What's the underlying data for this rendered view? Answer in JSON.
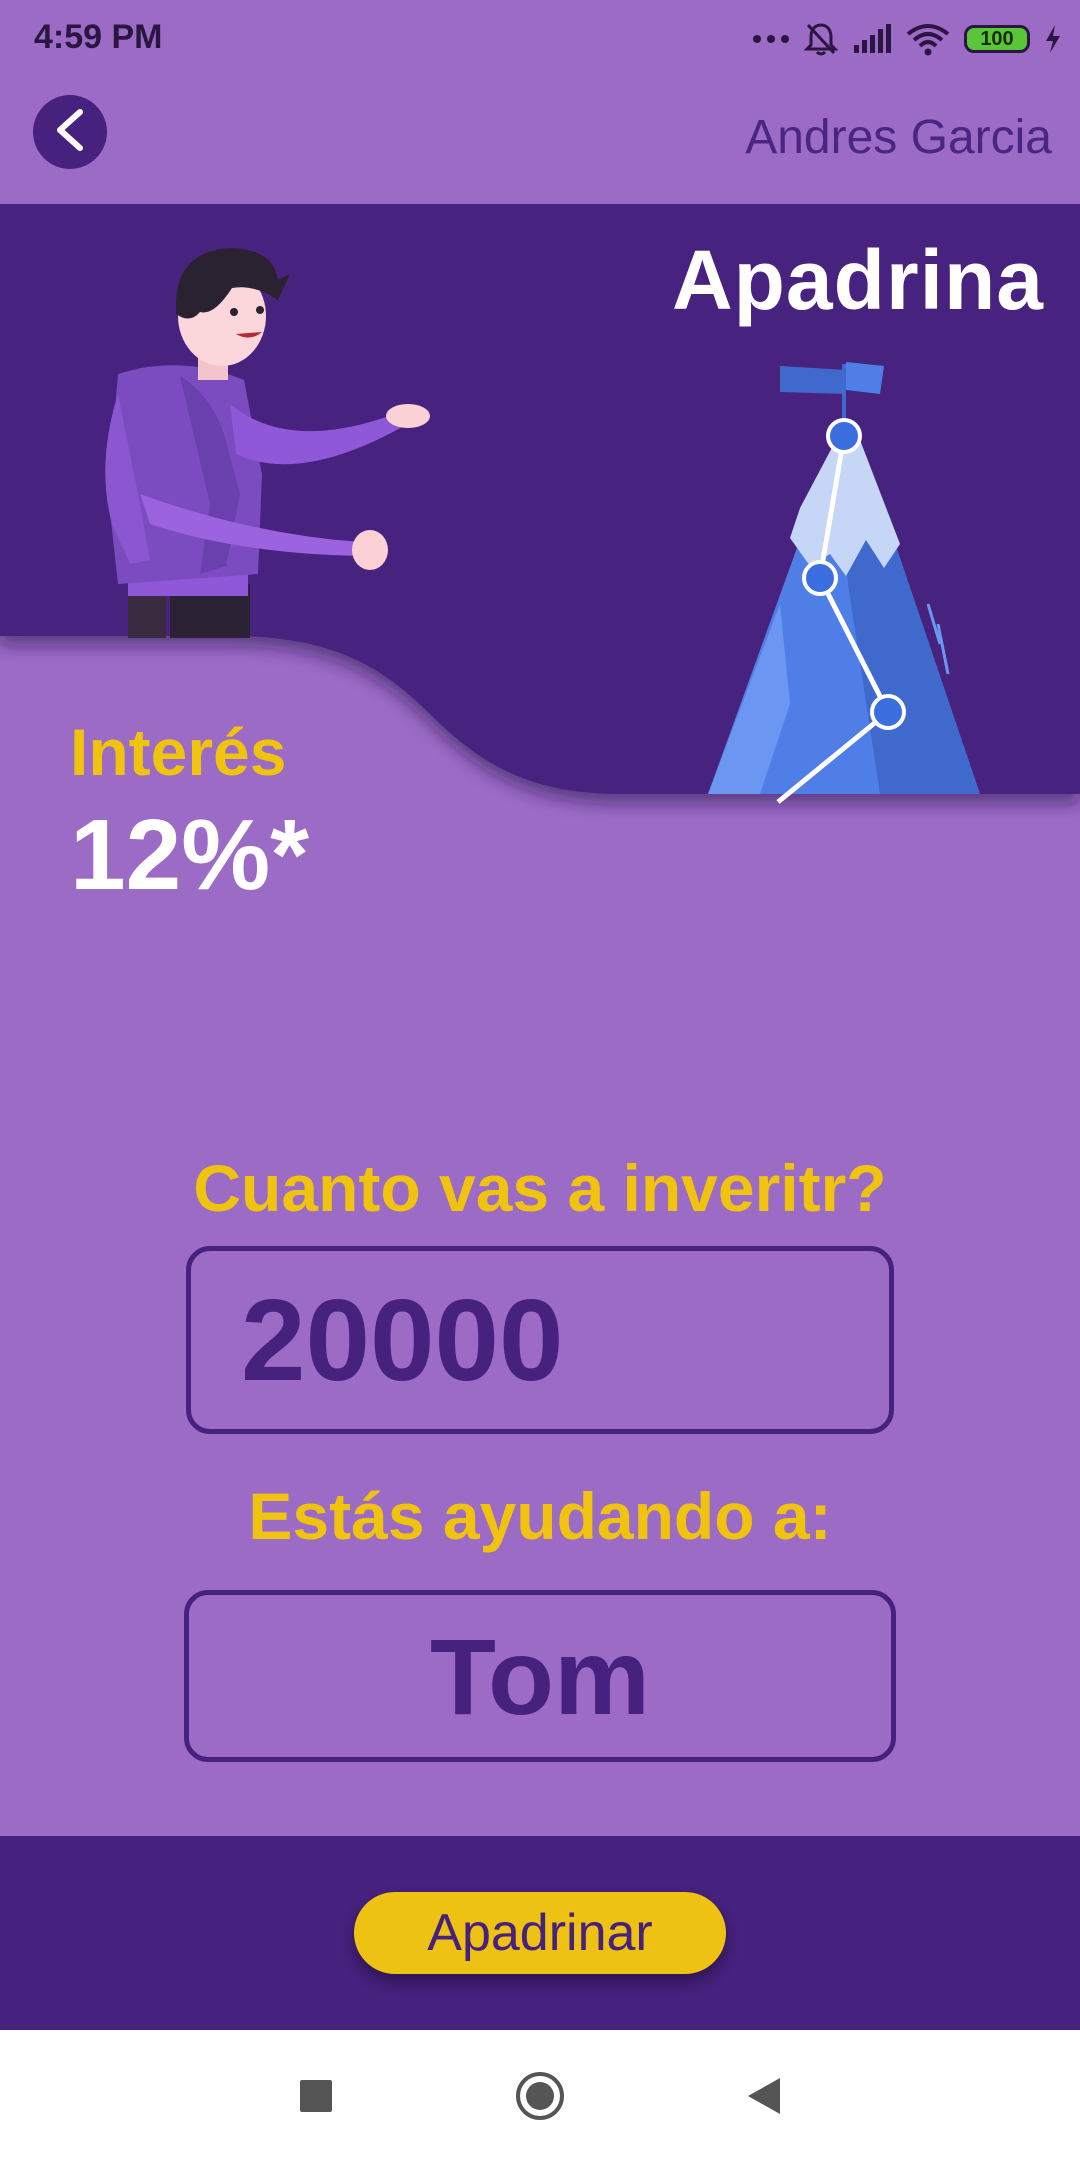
{
  "status_bar": {
    "time": "4:59 PM",
    "battery": "100",
    "icons": [
      "more-dots-icon",
      "bell-muted-icon",
      "signal-icon",
      "wifi-icon",
      "battery-icon",
      "charging-icon"
    ]
  },
  "header": {
    "back_icon": "chevron-left-icon",
    "user_name": "Andres Garcia"
  },
  "hero": {
    "title": "Apadrina",
    "illustration": "person-presenting-mountain-chart"
  },
  "interest": {
    "label": "Interés",
    "value": "12%*"
  },
  "investment": {
    "question": "Cuanto vas a inveritr?",
    "amount": "20000"
  },
  "helping": {
    "label": "Estás ayudando a:",
    "name": "Tom"
  },
  "actions": {
    "primary_label": "Apadrinar"
  },
  "nav_bar": {
    "items": [
      "recents-square-icon",
      "home-circle-icon",
      "back-triangle-icon"
    ]
  },
  "colors": {
    "background": "#9b6bc6",
    "dark_purple": "#46217e",
    "accent_yellow": "#f0c30f",
    "white": "#ffffff"
  }
}
